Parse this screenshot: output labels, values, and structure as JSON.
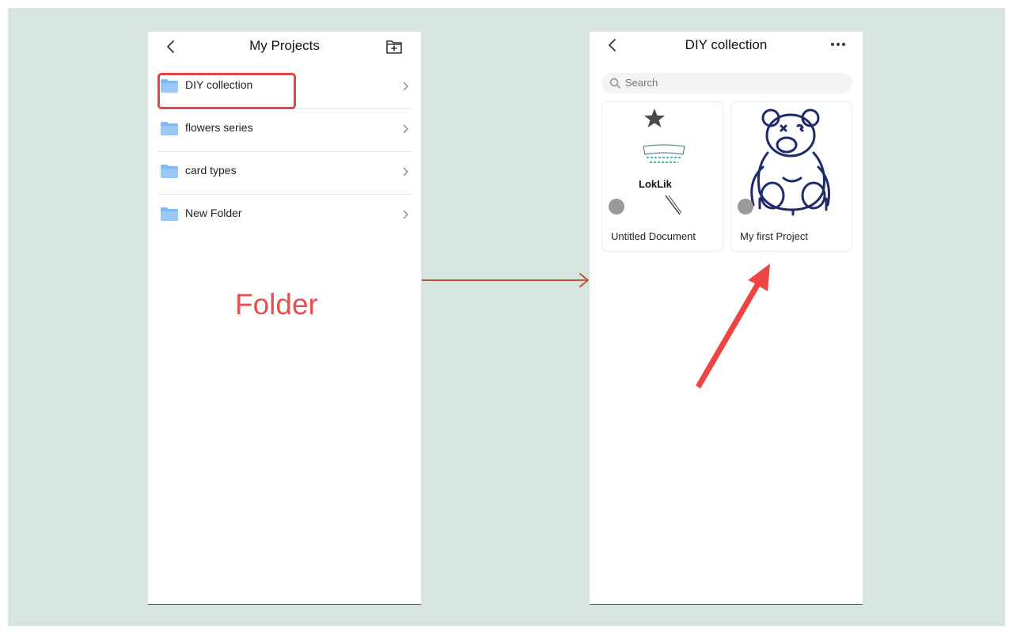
{
  "left_screen": {
    "title": "My Projects",
    "icons": {
      "back": "chevron-left-icon",
      "add_folder": "folder-plus-icon"
    },
    "folders": [
      {
        "name": "DIY collection",
        "icon": "folder-icon"
      },
      {
        "name": "flowers series",
        "icon": "folder-icon"
      },
      {
        "name": "card types",
        "icon": "folder-icon"
      },
      {
        "name": "New Folder",
        "icon": "folder-icon"
      }
    ]
  },
  "annotation": {
    "label": "Folder",
    "highlight_color": "#e34545",
    "arrow_color": "#c0533b",
    "pointer_arrow_color": "#ef4444"
  },
  "right_screen": {
    "title": "DIY collection",
    "icons": {
      "back": "chevron-left-icon",
      "more": "more-horizontal-icon",
      "search": "search-icon"
    },
    "search": {
      "placeholder": "Search"
    },
    "cards": [
      {
        "name": "Untitled Document",
        "thumb_text": "LokLik"
      },
      {
        "name": "My first Project"
      }
    ]
  },
  "colors": {
    "backdrop": "#d6e5e0",
    "folder_icon": "#7fb8f3"
  }
}
